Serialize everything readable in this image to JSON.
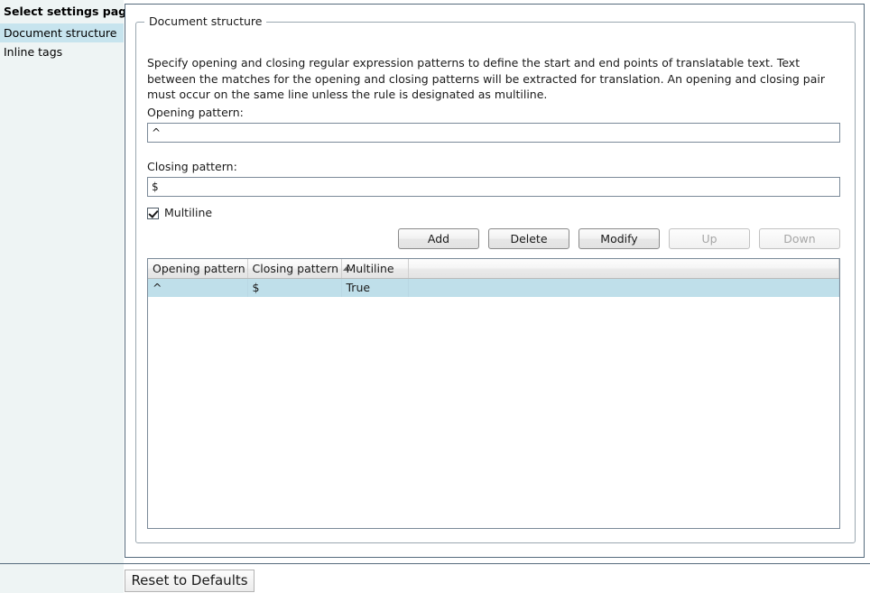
{
  "sidebar": {
    "title": "Select settings page:",
    "items": [
      {
        "label": "Document structure",
        "selected": true
      },
      {
        "label": "Inline tags",
        "selected": false
      }
    ]
  },
  "groupbox": {
    "legend": "Document structure",
    "description": "Specify opening and closing regular expression patterns to define the start and end points of translatable text. Text between the matches for the opening and closing patterns will be extracted for translation. An opening and closing pair must occur on the same line unless the rule is designated as multiline."
  },
  "fields": {
    "opening_label": "Opening pattern:",
    "opening_value": "^",
    "closing_label": "Closing pattern:",
    "closing_value": "$",
    "multiline_label": "Multiline",
    "multiline_checked": true
  },
  "buttons": {
    "add": "Add",
    "delete": "Delete",
    "modify": "Modify",
    "up": "Up",
    "down": "Down"
  },
  "table": {
    "columns": [
      {
        "label": "Opening pattern",
        "sort": "none"
      },
      {
        "label": "Closing pattern",
        "sort": "asc"
      },
      {
        "label": "Multiline",
        "sort": "none"
      },
      {
        "label": "",
        "sort": "none"
      }
    ],
    "rows": [
      {
        "opening": "^",
        "closing": "$",
        "multiline": "True",
        "spacer": "",
        "selected": true
      }
    ]
  },
  "footer": {
    "reset_label": "Reset to Defaults"
  },
  "colors": {
    "sidebar_background": "#eef4f4",
    "selection": "#c7e4ee",
    "row_selection": "#bfdfea",
    "panel_border": "#566b7d"
  }
}
